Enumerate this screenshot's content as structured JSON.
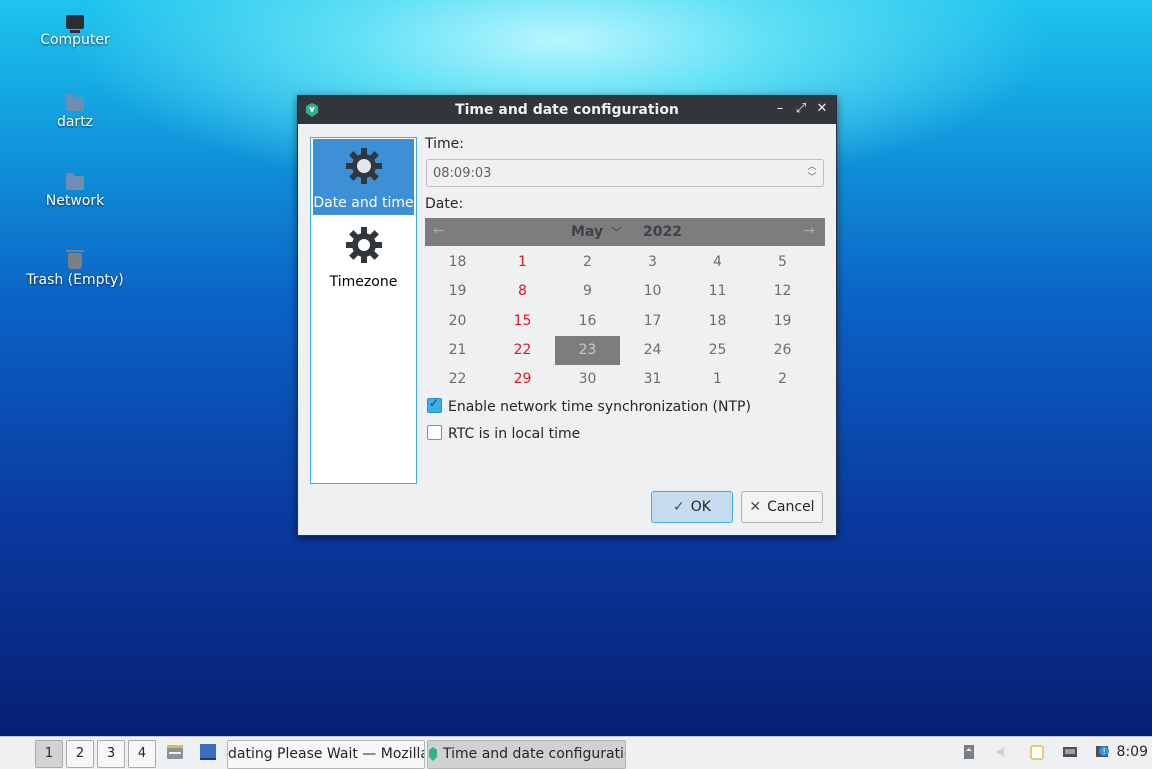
{
  "desktop": {
    "icons": [
      {
        "label": "Computer"
      },
      {
        "label": "dartz"
      },
      {
        "label": "Network"
      },
      {
        "label": "Trash (Empty)"
      }
    ]
  },
  "dialog": {
    "title": "Time and date configuration",
    "sidebar": [
      {
        "label": "Date and time",
        "selected": true
      },
      {
        "label": "Timezone",
        "selected": false
      }
    ],
    "time_label": "Time:",
    "time_value": "08:09:03",
    "date_label": "Date:",
    "calendar": {
      "month": "May",
      "year": "2022",
      "selected_day": "23",
      "weeks": [
        [
          "18",
          "1",
          "2",
          "3",
          "4",
          "5"
        ],
        [
          "19",
          "8",
          "9",
          "10",
          "11",
          "12"
        ],
        [
          "20",
          "15",
          "16",
          "17",
          "18",
          "19"
        ],
        [
          "21",
          "22",
          "23",
          "24",
          "25",
          "26"
        ],
        [
          "22",
          "29",
          "30",
          "31",
          "1",
          "2"
        ]
      ]
    },
    "ntp_label": "Enable network time synchronization (NTP)",
    "ntp_checked": true,
    "rtc_label": "RTC is in local time",
    "rtc_checked": false,
    "ok_label": "OK",
    "cancel_label": "Cancel"
  },
  "taskbar": {
    "workspaces": [
      "1",
      "2",
      "3",
      "4"
    ],
    "active_workspace": "1",
    "tasks": [
      {
        "label": "dating Please Wait — Mozilla"
      },
      {
        "label": "Time and date configuratio"
      }
    ],
    "clock": "8:09"
  },
  "colors": {
    "accent": "#3daee9",
    "selection": "#3d8fd6",
    "sunday": "#da1a2b",
    "titlebar": "#31363b"
  }
}
